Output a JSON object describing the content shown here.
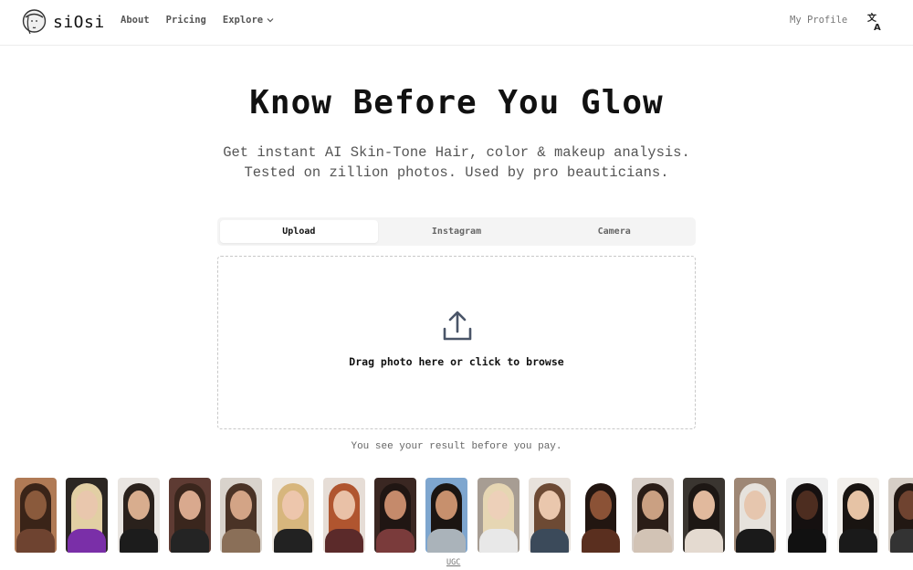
{
  "header": {
    "logo_text": "siOsi",
    "nav": [
      {
        "label": "About"
      },
      {
        "label": "Pricing"
      },
      {
        "label": "Explore"
      }
    ],
    "profile_label": "My Profile",
    "lang_icon": "translate-icon"
  },
  "hero": {
    "title": "Know Before You Glow",
    "subtitle_line1": "Get instant AI Skin-Tone Hair, color & makeup analysis.",
    "subtitle_line2": "Tested on zillion photos. Used by pro beauticians."
  },
  "tabs": [
    {
      "label": "Upload",
      "active": true
    },
    {
      "label": "Instagram",
      "active": false
    },
    {
      "label": "Camera",
      "active": false
    }
  ],
  "dropzone": {
    "icon": "upload-icon",
    "text": "Drag photo here or click to browse"
  },
  "note": "You see your result before you pay.",
  "thumbnails": [
    {
      "bg": "#b07a55",
      "hair": "#3a2418",
      "face": "#8a5a3c",
      "body": "#6e4330"
    },
    {
      "bg": "#2b2622",
      "hair": "#e2cfa4",
      "face": "#e9c7ad",
      "body": "#7a2fa8"
    },
    {
      "bg": "#e9e5e1",
      "hair": "#2a211c",
      "face": "#d8ad8e",
      "body": "#1c1c1c"
    },
    {
      "bg": "#5e3b33",
      "hair": "#3a261d",
      "face": "#d9a98e",
      "body": "#242424"
    },
    {
      "bg": "#d9d3cc",
      "hair": "#4a3326",
      "face": "#d3a486",
      "body": "#8a6f58"
    },
    {
      "bg": "#efe9e2",
      "hair": "#d7b67d",
      "face": "#edc6ac",
      "body": "#222222"
    },
    {
      "bg": "#e6ddd6",
      "hair": "#b0552f",
      "face": "#e9c1a7",
      "body": "#5b2a2a"
    },
    {
      "bg": "#3a2722",
      "hair": "#201613",
      "face": "#c58a6b",
      "body": "#7a3b3b"
    },
    {
      "bg": "#7ea6cf",
      "hair": "#1b1512",
      "face": "#c7906d",
      "body": "#aab3ba"
    },
    {
      "bg": "#a79d93",
      "hair": "#e6d6b3",
      "face": "#edd0b9",
      "body": "#e8e8e8"
    },
    {
      "bg": "#e8e2dc",
      "hair": "#6d4a34",
      "face": "#eac7ad",
      "body": "#3b4a5a"
    },
    {
      "bg": "#ffffff",
      "hair": "#221611",
      "face": "#8b5236",
      "body": "#5a2f1f"
    },
    {
      "bg": "#d8cfc8",
      "hair": "#2a1d17",
      "face": "#caa082",
      "body": "#d2c3b5"
    },
    {
      "bg": "#3a3530",
      "hair": "#1d1714",
      "face": "#e1b99d",
      "body": "#e4dad0"
    },
    {
      "bg": "#9e8775",
      "hair": "#e6e2dc",
      "face": "#e6c6ae",
      "body": "#1a1a1a"
    },
    {
      "bg": "#efefef",
      "hair": "#151010",
      "face": "#4d2d20",
      "body": "#111111"
    },
    {
      "bg": "#f2efeb",
      "hair": "#191411",
      "face": "#e6c3a5",
      "body": "#1a1a1a"
    },
    {
      "bg": "#d6cec6",
      "hair": "#221813",
      "face": "#6f4330",
      "body": "#333333"
    }
  ],
  "ugc_label": "UGC"
}
